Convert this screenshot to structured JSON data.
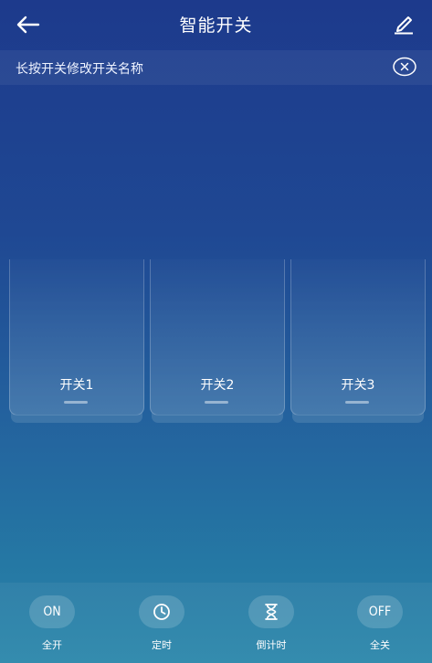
{
  "header": {
    "title": "智能开关",
    "back_icon": "arrow-left-icon",
    "edit_icon": "pencil-icon"
  },
  "notice": {
    "text": "长按开关修改开关名称",
    "close_icon": "close-circle-icon"
  },
  "switches": [
    {
      "label": "开关1"
    },
    {
      "label": "开关2"
    },
    {
      "label": "开关3"
    }
  ],
  "actions": [
    {
      "label": "全开",
      "badge": "ON",
      "icon": "on-text-icon"
    },
    {
      "label": "定时",
      "badge": "",
      "icon": "clock-icon"
    },
    {
      "label": "倒计时",
      "badge": "",
      "icon": "hourglass-icon"
    },
    {
      "label": "全关",
      "badge": "OFF",
      "icon": "off-text-icon"
    }
  ],
  "colors": {
    "background_top": "#1d3a8c",
    "background_bottom": "#2a86aa",
    "text": "#ffffff"
  }
}
